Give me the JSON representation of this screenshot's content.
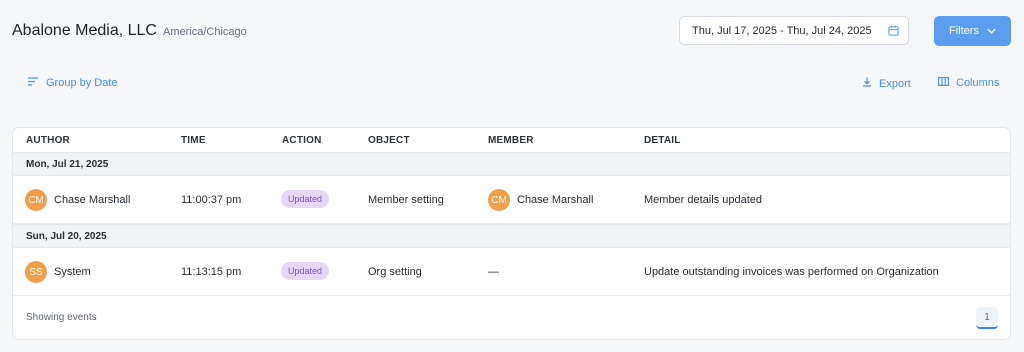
{
  "header": {
    "title": "Abalone Media, LLC",
    "timezone": "America/Chicago",
    "date_range": "Thu, Jul 17, 2025 - Thu, Jul 24, 2025",
    "filters_label": "Filters"
  },
  "toolbar": {
    "group_by_label": "Group by Date",
    "export_label": "Export",
    "columns_label": "Columns"
  },
  "table": {
    "columns": [
      "AUTHOR",
      "TIME",
      "ACTION",
      "OBJECT",
      "MEMBER",
      "DETAIL"
    ],
    "groups": [
      {
        "date": "Mon, Jul 21, 2025",
        "rows": [
          {
            "author_initials": "CM",
            "author": "Chase Marshall",
            "time": "11:00:37 pm",
            "action": "Updated",
            "object": "Member setting",
            "member_initials": "CM",
            "member": "Chase Marshall",
            "detail": "Member details updated"
          }
        ]
      },
      {
        "date": "Sun, Jul 20, 2025",
        "rows": [
          {
            "author_initials": "SS",
            "author": "System",
            "time": "11:13:15 pm",
            "action": "Updated",
            "object": "Org setting",
            "member": "—",
            "detail": "Update outstanding invoices was performed on Organization"
          }
        ]
      }
    ]
  },
  "footer": {
    "showing_label": "Showing events",
    "current_page": "1"
  },
  "colors": {
    "accent": "#5b9ef0",
    "avatar": "#f0a04b",
    "badge_bg": "#e4d7f7",
    "badge_text": "#7a4fc4"
  }
}
